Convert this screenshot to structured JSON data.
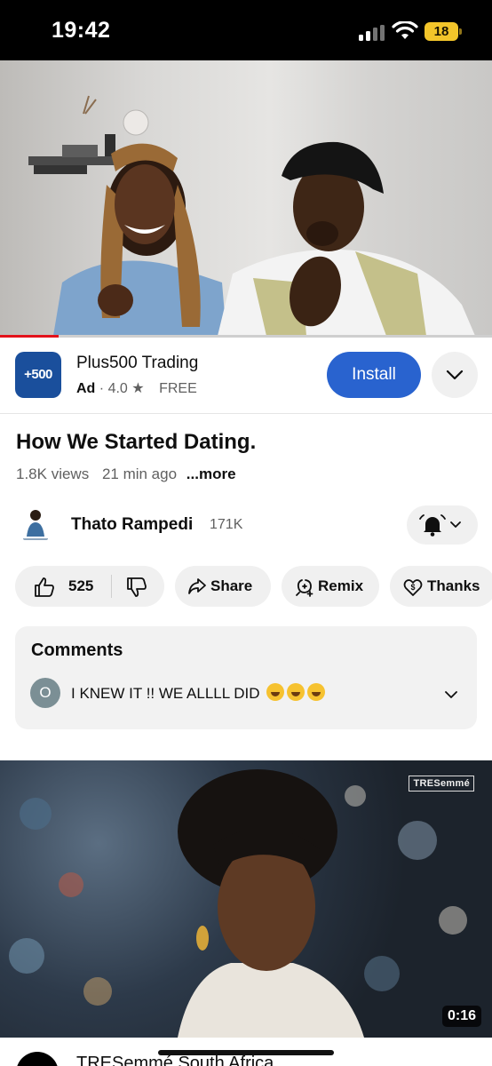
{
  "status_bar": {
    "time": "19:42",
    "battery": "18"
  },
  "player": {
    "progress": 0.12
  },
  "ad": {
    "logo_text": "+500",
    "name": "Plus500 Trading",
    "label": "Ad",
    "rating": "4.0",
    "price": "FREE",
    "install_label": "Install"
  },
  "video": {
    "title": "How We Started Dating.",
    "views": "1.8K views",
    "ago": "21 min ago",
    "more": "...more"
  },
  "channel": {
    "name": "Thato Rampedi",
    "subscribers": "171K"
  },
  "actions": {
    "likes": "525",
    "share": "Share",
    "remix": "Remix",
    "thanks": "Thanks"
  },
  "comments": {
    "title": "Comments",
    "avatar_initial": "O",
    "top_comment": "I KNEW IT !! WE ALLLL DID"
  },
  "next_video": {
    "brand": "TRESemmé",
    "duration": "0:16",
    "channel_name": "TRESemmé South Africa"
  },
  "colors": {
    "install": "#2963cf",
    "progress": "#e3121a",
    "ad_logo": "#1a4f9c"
  }
}
